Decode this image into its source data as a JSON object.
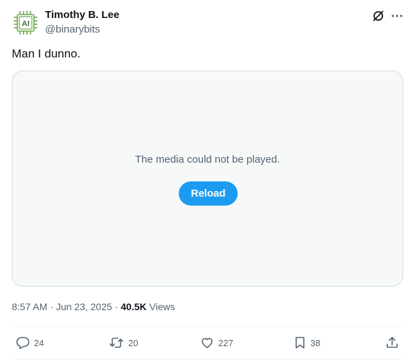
{
  "author": {
    "name": "Timothy B. Lee",
    "handle": "@binarybits",
    "avatar_text": "AI"
  },
  "header_icons": {
    "grok": "grok-icon",
    "more": "more-icon"
  },
  "tweet": {
    "text": "Man I dunno."
  },
  "media": {
    "message": "The media could not be played.",
    "reload_label": "Reload"
  },
  "meta": {
    "time": "8:57 AM",
    "sep1": "·",
    "date": "Jun 23, 2025",
    "sep2": "·",
    "views_count": "40.5K",
    "views_label": "Views"
  },
  "actions": {
    "replies": "24",
    "retweets": "20",
    "likes": "227",
    "bookmarks": "38"
  },
  "colors": {
    "accent": "#1d9bf0",
    "text": "#0f1419",
    "secondary": "#536471",
    "avatar_green": "#6aa84f"
  }
}
